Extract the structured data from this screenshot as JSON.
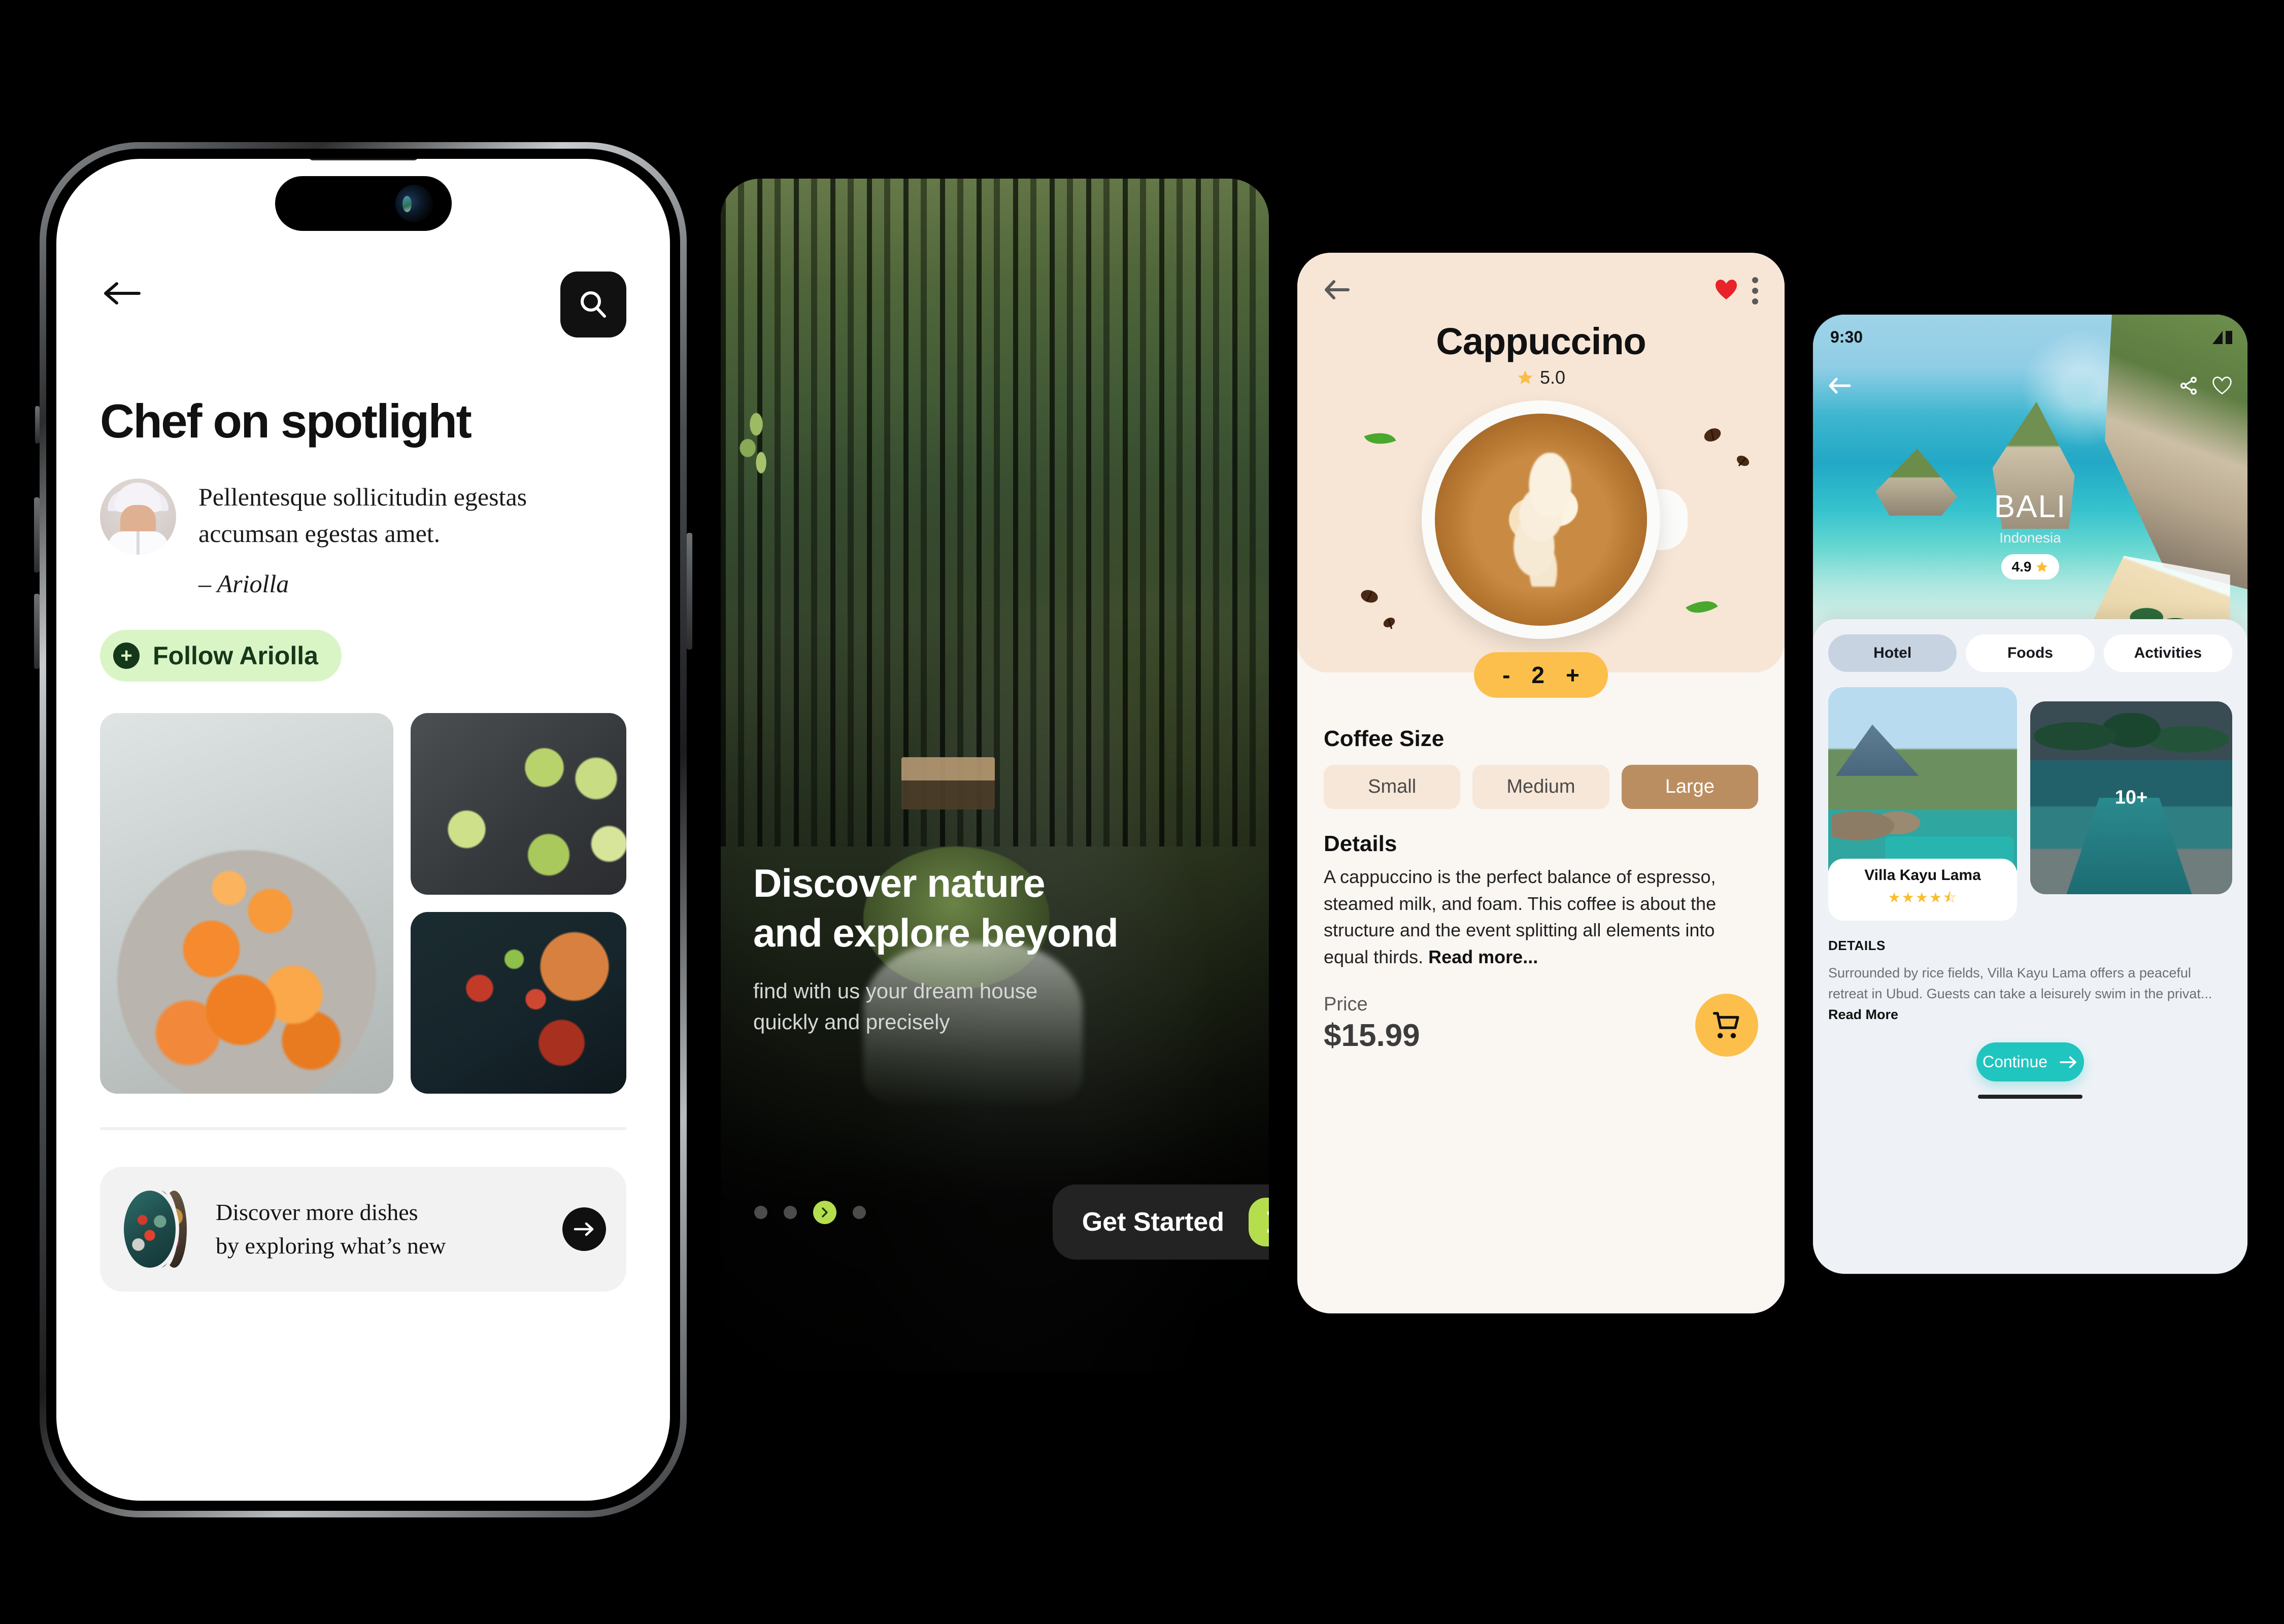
{
  "screen1": {
    "icons": {
      "back": "back-arrow-icon",
      "search": "search-icon",
      "plus": "plus-icon",
      "arrow_right": "arrow-right-icon"
    },
    "title": "Chef on spotlight",
    "chef": {
      "quote": "Pellentesque sollicitudin egestas accumsan egestas amet.",
      "attribution": "– Ariolla",
      "avatar_alt": "chef-portrait"
    },
    "follow_button": "Follow Ariolla",
    "gallery": [
      {
        "alt": "carrot-salad-bowl"
      },
      {
        "alt": "avocado-toast-board"
      },
      {
        "alt": "grilled-salmon-plate"
      }
    ],
    "discover_card": {
      "line1": "Discover more dishes",
      "line2": "by exploring what’s new"
    },
    "colors": {
      "follow_bg": "#d9f5c6",
      "follow_text": "#16381a",
      "accent_dark": "#111111"
    }
  },
  "screen2": {
    "icons": {
      "chevron_right": "chevron-right-icon"
    },
    "headline_line1": "Discover nature",
    "headline_line2": "and explore beyond",
    "sub_line1": "find with us your dream house",
    "sub_line2": "quickly and precisely",
    "cta_label": "Get Started",
    "pagination": {
      "total": 4,
      "active_index": 2
    },
    "colors": {
      "accent": "#b5de4f",
      "cta_bg": "#232323"
    }
  },
  "screen3": {
    "icons": {
      "back": "back-arrow-icon",
      "heart": "heart-filled-icon",
      "menu": "kebab-menu-icon",
      "star": "star-icon",
      "cart": "shopping-cart-icon"
    },
    "title": "Cappuccino",
    "rating": "5.0",
    "quantity": {
      "minus": "-",
      "value": "2",
      "plus": "+"
    },
    "size_heading": "Coffee Size",
    "sizes": [
      {
        "label": "Small",
        "selected": false
      },
      {
        "label": "Medium",
        "selected": false
      },
      {
        "label": "Large",
        "selected": true
      }
    ],
    "details_heading": "Details",
    "details_text": "A cappuccino is the perfect balance of espresso, steamed milk, and foam. This coffee is about the structure and the event splitting all elements into equal thirds.",
    "read_more": "Read more...",
    "price_label": "Price",
    "price_value": "$15.99",
    "colors": {
      "hero_bg": "#f7e6d6",
      "body_bg": "#faf6f2",
      "accent": "#fcbf4b",
      "size_selected": "#bb8e61",
      "heart": "#e8232a"
    }
  },
  "screen4": {
    "icons": {
      "back": "back-arrow-icon",
      "share": "share-icon",
      "heart": "heart-outline-icon",
      "arrow_right": "arrow-right-icon",
      "signal": "signal-icon"
    },
    "status_time": "9:30",
    "city": "BALI",
    "country": "Indonesia",
    "score": "4.9",
    "tabs": [
      {
        "label": "Hotel",
        "active": true
      },
      {
        "label": "Foods",
        "active": false
      },
      {
        "label": "Activities",
        "active": false
      }
    ],
    "villa": {
      "name": "Villa Kayu Lama",
      "stars": "★★★★⯪"
    },
    "more_badge": "10+",
    "details_heading": "DETAILS",
    "details_text": "Surrounded by rice fields, Villa Kayu Lama offers a peaceful retreat in Ubud. Guests can take a leisurely swim in the privat...",
    "read_more": "Read More",
    "cta_label": "Continue",
    "colors": {
      "sheet_bg": "#eef2f7",
      "tab_active": "#c7d3e0",
      "cta": "#20c5c0",
      "stars": "#fbbd2a"
    }
  }
}
